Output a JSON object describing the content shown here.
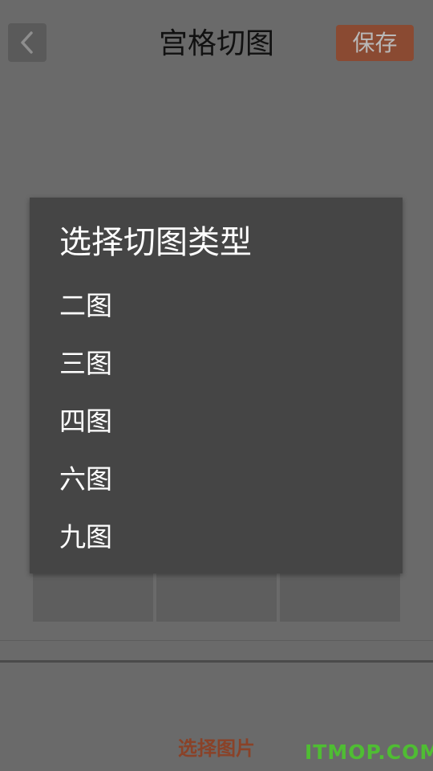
{
  "header": {
    "back_icon": "chevron-left-icon",
    "title": "宫格切图",
    "save_label": "保存"
  },
  "dialog": {
    "title": "选择切图类型",
    "options": [
      {
        "label": "二图"
      },
      {
        "label": "三图"
      },
      {
        "label": "四图"
      },
      {
        "label": "六图"
      },
      {
        "label": "九图"
      }
    ]
  },
  "bottom": {
    "select_image_label": "选择图片"
  },
  "watermark": "ITMOP.COM",
  "colors": {
    "background": "#6a6a6a",
    "dialog_background": "#454545",
    "accent": "#8a4a32",
    "watermark": "#4fbd33"
  }
}
